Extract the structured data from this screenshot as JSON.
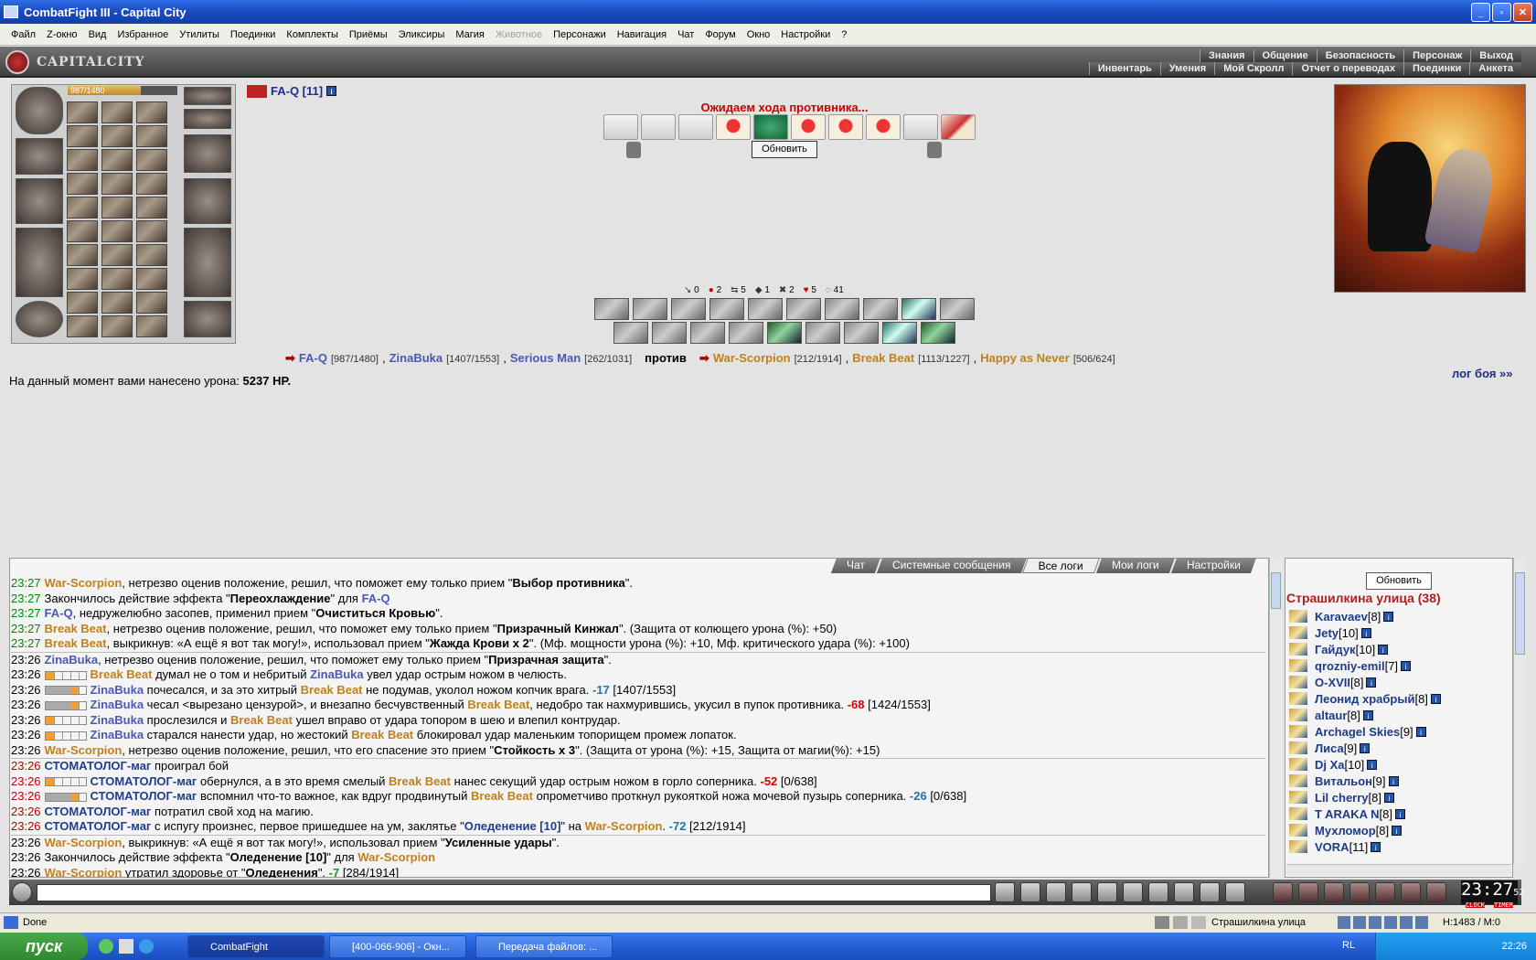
{
  "window": {
    "title": "CombatFight III - Capital City"
  },
  "menu": [
    "Файл",
    "Z-окно",
    "Вид",
    "Избранное",
    "Утилиты",
    "Поединки",
    "Комплекты",
    "Приёмы",
    "Эликсиры",
    "Магия",
    "Животное",
    "Персонажи",
    "Навигация",
    "Чат",
    "Форум",
    "Окно",
    "Настройки",
    "?"
  ],
  "menu_disabled": "Животное",
  "game": {
    "logo": "CAPITALCITY",
    "top_tabs_1": [
      "Знания",
      "Общение",
      "Безопасность",
      "Персонаж",
      "Выход"
    ],
    "top_tabs_2": [
      "Инвентарь",
      "Умения",
      "Мой Скролл",
      "Отчет о переводах",
      "Поединки",
      "Анкета"
    ],
    "hp_text": "987/1480",
    "hp_fraction": 0.667,
    "player_name": "FA-Q [11]",
    "waiting": "Ожидаем хода противника...",
    "refresh": "Обновить",
    "stats": [
      "0",
      "2",
      "5",
      "1",
      "2",
      "5",
      "41"
    ],
    "vs": {
      "team1": [
        {
          "name": "FA-Q",
          "hp": "[987/1480]"
        },
        {
          "name": "ZinaBuka",
          "hp": "[1407/1553]"
        },
        {
          "name": "Serious Man",
          "hp": "[262/1031]"
        }
      ],
      "versus": "против",
      "team2": [
        {
          "name": "War-Scorpion",
          "hp": "[212/1914]"
        },
        {
          "name": "Break Beat",
          "hp": "[1113/1227]"
        },
        {
          "name": "Happy as Never",
          "hp": "[506/624]"
        }
      ]
    },
    "damage_label": "На данный момент вами нанесено урона:",
    "damage_value": "5237 HP.",
    "log_link": "лог боя »»"
  },
  "chat": {
    "tabs": [
      "Чат",
      "Системные сообщения",
      "Все логи",
      "Мои логи",
      "Настройки"
    ],
    "active_tab": "Все логи",
    "lines": [
      {
        "time": "23:27",
        "parts": [
          [
            "War-Scorpion",
            "o"
          ],
          [
            ", нетрезво оценив положение, решил, что поможет ему только прием \"",
            ""
          ],
          [
            "Выбор противника",
            "b"
          ],
          [
            "\".",
            ""
          ]
        ]
      },
      {
        "time": "23:27",
        "parts": [
          [
            "Закончилось действие эффекта \"",
            ""
          ],
          [
            "Переохлаждение",
            "b"
          ],
          [
            "\" для ",
            ""
          ],
          [
            "FA-Q",
            "p"
          ]
        ]
      },
      {
        "time": "23:27",
        "parts": [
          [
            "FA-Q",
            "p"
          ],
          [
            ", недружелюбно засопев, применил прием \"",
            ""
          ],
          [
            "Очиститься Кровью",
            "b"
          ],
          [
            "\".",
            ""
          ]
        ]
      },
      {
        "time": "23:27",
        "parts": [
          [
            "Break Beat",
            "o"
          ],
          [
            ", нетрезво оценив положение, решил, что поможет ему только прием \"",
            ""
          ],
          [
            "Призрачный Кинжал",
            "b"
          ],
          [
            "\". (Защита от колющего урона (%): +50)",
            ""
          ]
        ]
      },
      {
        "time": "23:27",
        "parts": [
          [
            "Break Beat",
            "o"
          ],
          [
            ", выкрикнув: «А ещё я вот так могу!», использовал прием \"",
            ""
          ],
          [
            "Жажда Крови x 2",
            "b"
          ],
          [
            "\". (Мф. мощности урона (%): +10, Мф. критического удара (%): +100)",
            ""
          ]
        ]
      },
      {
        "time": "23:26",
        "sep": true,
        "parts": [
          [
            "ZinaBuka",
            "p"
          ],
          [
            ", нетрезво оценив положение, решил, что поможет ему только прием \"",
            ""
          ],
          [
            "Призрачная защита",
            "b"
          ],
          [
            "\".",
            ""
          ]
        ]
      },
      {
        "time": "23:26",
        "box": "f1",
        "parts": [
          [
            "Break Beat",
            "o"
          ],
          [
            " думал не о том и небритый ",
            ""
          ],
          [
            "ZinaBuka",
            "p"
          ],
          [
            " увел удар острым ножом в челюсть.",
            ""
          ]
        ]
      },
      {
        "time": "23:26",
        "box": "f3",
        "parts": [
          [
            "ZinaBuka",
            "p"
          ],
          [
            " почесался, и за это хитрый ",
            ""
          ],
          [
            "Break Beat",
            "o"
          ],
          [
            " не подумав, уколол ножом копчик врага. ",
            ""
          ],
          [
            "-17",
            "n"
          ],
          [
            " [1407/1553]",
            ""
          ]
        ]
      },
      {
        "time": "23:26",
        "box": "f3",
        "parts": [
          [
            "ZinaBuka",
            "p"
          ],
          [
            " чесал <вырезано цензурой>, и внезапно бесчувственный ",
            ""
          ],
          [
            "Break Beat",
            "o"
          ],
          [
            ", недобро так нахмурившись, укусил в пупок противника. ",
            ""
          ],
          [
            "-68",
            "r"
          ],
          [
            " [1424/1553]",
            ""
          ]
        ]
      },
      {
        "time": "23:26",
        "box": "f1",
        "parts": [
          [
            "ZinaBuka",
            "p"
          ],
          [
            " прослезился и ",
            ""
          ],
          [
            "Break Beat",
            "o"
          ],
          [
            " ушел вправо от удара топором в шею и влепил контрудар.",
            ""
          ]
        ]
      },
      {
        "time": "23:26",
        "box": "f1",
        "parts": [
          [
            "ZinaBuka",
            "p"
          ],
          [
            " старался нанести удар, но жестокий ",
            ""
          ],
          [
            "Break Beat",
            "o"
          ],
          [
            " блокировал удар маленьким топорищем промеж лопаток.",
            ""
          ]
        ]
      },
      {
        "time": "23:26",
        "parts": [
          [
            "War-Scorpion",
            "o"
          ],
          [
            ", нетрезво оценив положение, решил, что его спасение это прием \"",
            ""
          ],
          [
            "Стойкость x 3",
            "b"
          ],
          [
            "\". (Защита от урона (%): +15, Защита от магии(%): +15)",
            ""
          ]
        ]
      },
      {
        "time": "23:26",
        "sep": true,
        "parts": [
          [
            "СТОМАТОЛОГ-маг",
            "d"
          ],
          [
            " проиграл бой",
            ""
          ]
        ]
      },
      {
        "time": "23:26",
        "box": "f1",
        "parts": [
          [
            "СТОМАТОЛОГ-маг",
            "d"
          ],
          [
            " обернулся, а в это время смелый ",
            ""
          ],
          [
            "Break Beat",
            "o"
          ],
          [
            " нанес секущий удар острым ножом в горло соперника. ",
            ""
          ],
          [
            "-52",
            "r"
          ],
          [
            " [0/638]",
            ""
          ]
        ]
      },
      {
        "time": "23:26",
        "box": "f3",
        "parts": [
          [
            "СТОМАТОЛОГ-маг",
            "d"
          ],
          [
            " вспомнил что-то важное, как вдруг продвинутый ",
            ""
          ],
          [
            "Break Beat",
            "o"
          ],
          [
            " опрометчиво проткнул рукояткой ножа мочевой пузырь соперника. ",
            ""
          ],
          [
            "-26",
            "n"
          ],
          [
            " [0/638]",
            ""
          ]
        ]
      },
      {
        "time": "23:26",
        "parts": [
          [
            "СТОМАТОЛОГ-маг",
            "d"
          ],
          [
            " потратил свой ход на магию.",
            ""
          ]
        ]
      },
      {
        "time": "23:26",
        "parts": [
          [
            "СТОМАТОЛОГ-маг",
            "d"
          ],
          [
            " с испугу произнес, первое пришедшее на ум, заклятье \"",
            ""
          ],
          [
            "Оледенение [10]",
            "db"
          ],
          [
            "\" на ",
            ""
          ],
          [
            "War-Scorpion",
            "o"
          ],
          [
            ". ",
            ""
          ],
          [
            "-72",
            "n"
          ],
          [
            " [212/1914]",
            ""
          ]
        ]
      },
      {
        "time": "23:26",
        "sep": true,
        "parts": [
          [
            "War-Scorpion",
            "o"
          ],
          [
            ", выкрикнув: «А ещё я вот так могу!», использовал прием \"",
            ""
          ],
          [
            "Усиленные удары",
            "b"
          ],
          [
            "\".",
            ""
          ]
        ]
      },
      {
        "time": "23:26",
        "parts": [
          [
            "Закончилось действие эффекта \"",
            ""
          ],
          [
            "Оледенение [10]",
            "b"
          ],
          [
            "\" для ",
            ""
          ],
          [
            "War-Scorpion",
            "o"
          ]
        ]
      },
      {
        "time": "23:26",
        "parts": [
          [
            "War-Scorpion",
            "o"
          ],
          [
            " утратил здоровье от \"",
            ""
          ],
          [
            "Оледенения",
            "b"
          ],
          [
            "\". ",
            ""
          ],
          [
            "-7",
            "g"
          ],
          [
            " [284/1914]",
            ""
          ]
        ]
      }
    ]
  },
  "users": {
    "refresh": "Обновить",
    "street": "Страшилкина улица (38)",
    "list": [
      {
        "name": "Karavaev",
        "lvl": "[8]"
      },
      {
        "name": "Jety",
        "lvl": "[10]"
      },
      {
        "name": "Гайдук",
        "lvl": "[10]"
      },
      {
        "name": "qrozniy-emil",
        "lvl": "[7]"
      },
      {
        "name": "O-XVII",
        "lvl": "[8]"
      },
      {
        "name": "Леонид храбрый",
        "lvl": "[8]"
      },
      {
        "name": "altaur",
        "lvl": "[8]"
      },
      {
        "name": "Archagel Skies",
        "lvl": "[9]"
      },
      {
        "name": "Лиса",
        "lvl": "[9]"
      },
      {
        "name": "Dj Xa",
        "lvl": "[10]"
      },
      {
        "name": "Витальон",
        "lvl": "[9]"
      },
      {
        "name": "Lil cherry",
        "lvl": "[8]"
      },
      {
        "name": "T ARAKA N",
        "lvl": "[8]"
      },
      {
        "name": "Мухломор",
        "lvl": "[8]"
      },
      {
        "name": "VORA",
        "lvl": "[11]"
      }
    ]
  },
  "clock": {
    "time": "23:27",
    "sec": "52",
    "clock_label": "CLOCK",
    "timer_label": "TIMER"
  },
  "status": {
    "left": "Done",
    "location": "Страшилкина улица",
    "hm": "H:1483 / M:0"
  },
  "taskbar": {
    "start": "пуск",
    "items": [
      "CombatFight",
      "[400-066-906] - Окн...",
      "Передача файлов: ..."
    ],
    "lang": "RL",
    "time": "22:26"
  }
}
